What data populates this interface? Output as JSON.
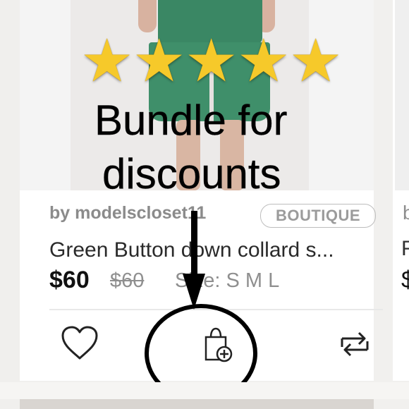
{
  "listing": {
    "overlay_line1": "Bundle for",
    "overlay_line2": "discounts",
    "seller": "by modelscloset11",
    "badge": "BOUTIQUE",
    "title": "Green Button down collard s...",
    "price": "$60",
    "original_price": "$60",
    "size": "Size: S M L",
    "rating": 5
  },
  "icons": {
    "star": "star-icon",
    "heart": "heart-icon",
    "bundle": "bag-plus-icon",
    "share": "repost-icon"
  },
  "adjacent": {
    "seller_initial": "b",
    "title_initial": "F",
    "price_initial": "$"
  },
  "colors": {
    "star": "#f6c92a",
    "badge_border": "#bdbdbd",
    "price": "#111111",
    "muted": "#8b8b8b"
  }
}
